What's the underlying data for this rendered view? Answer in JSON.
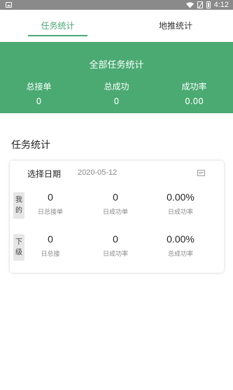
{
  "status_bar": {
    "time": "4:12",
    "icons": [
      "image-icon",
      "wifi-icon",
      "no-sim-icon",
      "battery-icon"
    ]
  },
  "tabs": [
    {
      "label": "任务统计",
      "active": true
    },
    {
      "label": "地推统计",
      "active": false
    }
  ],
  "colors": {
    "accent": "#4aaa72",
    "tab_active": "#4aa975"
  },
  "summary": {
    "title": "全部任务统计",
    "stats": [
      {
        "label": "总接单",
        "value": "0"
      },
      {
        "label": "总成功",
        "value": "0"
      },
      {
        "label": "成功率",
        "value": "0.00"
      }
    ]
  },
  "section": {
    "title": "任务统计"
  },
  "card": {
    "date_label": "选择日期",
    "date_value": "2020-05-12",
    "rows": [
      {
        "tag": [
          "我",
          "的"
        ],
        "cells": [
          {
            "value": "0",
            "caption": "日总接单"
          },
          {
            "value": "0",
            "caption": "日成功单"
          },
          {
            "value": "0.00%",
            "caption": "日成功率"
          }
        ]
      },
      {
        "tag": [
          "下",
          "级"
        ],
        "cells": [
          {
            "value": "0",
            "caption": "日总接"
          },
          {
            "value": "0",
            "caption": "日成功率"
          },
          {
            "value": "0.00%",
            "caption": "总成功率"
          }
        ]
      }
    ]
  }
}
